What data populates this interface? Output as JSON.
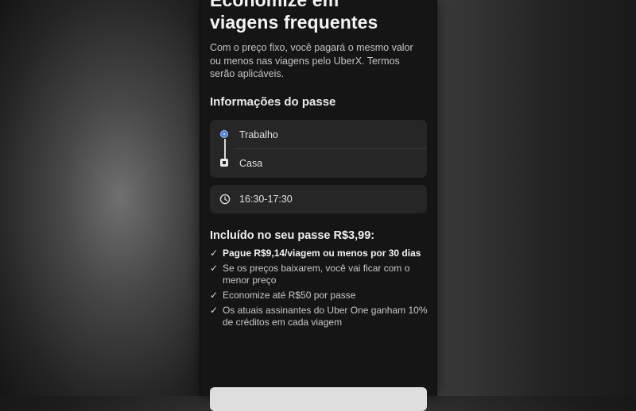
{
  "pass_screen": {
    "title_line1": "Economize em",
    "title_line2": "viagens frequentes",
    "subtitle": "Com o preço fixo, você pagará o mesmo valor ou menos nas viagens pelo UberX. Termos serão aplicáveis.",
    "info_heading": "Informações do passe",
    "route": {
      "origin": "Trabalho",
      "destination": "Casa"
    },
    "time_window": "16:30-17:30",
    "included_heading": "Incluído no seu passe R$3,99:",
    "benefits": [
      "Pague R$9,14/viagem ou menos por 30 dias",
      "Se os preços baixarem, você vai ficar com o menor preço",
      "Economize até R$50 por passe",
      "Os atuais assinantes do Uber One ganham 10% de créditos em cada viagem"
    ],
    "check_glyph": "✓"
  },
  "colors": {
    "origin_dot": "#4d7fe0",
    "card_bg": "#262626",
    "screen_bg": "#151515"
  },
  "icons": {
    "origin": "origin-dot-icon",
    "destination": "destination-square-icon",
    "time": "clock-icon",
    "benefit": "check-icon"
  }
}
